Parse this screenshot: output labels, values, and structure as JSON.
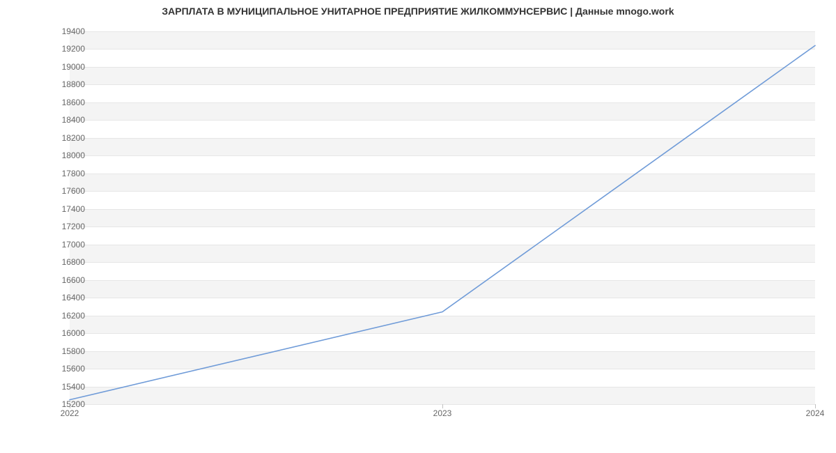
{
  "chart_data": {
    "type": "line",
    "title": "ЗАРПЛАТА В МУНИЦИПАЛЬНОЕ УНИТАРНОЕ ПРЕДПРИЯТИЕ ЖИЛКОММУНСЕРВИС | Данные mnogo.work",
    "xlabel": "",
    "ylabel": "",
    "x": [
      2022,
      2023,
      2024
    ],
    "values": [
      15250,
      16240,
      19240
    ],
    "x_ticks": [
      2022,
      2023,
      2024
    ],
    "y_ticks": [
      15200,
      15400,
      15600,
      15800,
      16000,
      16200,
      16400,
      16600,
      16800,
      17000,
      17200,
      17400,
      17600,
      17800,
      18000,
      18200,
      18400,
      18600,
      18800,
      19000,
      19200,
      19400
    ],
    "xlim": [
      2022,
      2024
    ],
    "ylim": [
      15200,
      19400
    ],
    "grid": true,
    "line_color": "#6f9bd8"
  }
}
